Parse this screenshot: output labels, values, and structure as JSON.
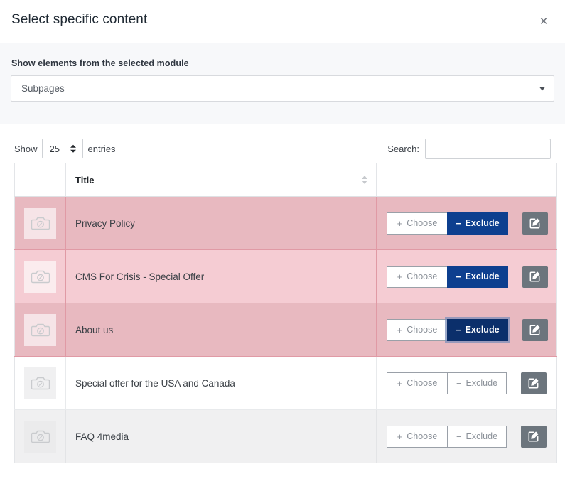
{
  "modal": {
    "title": "Select specific content",
    "close_label": "×"
  },
  "module": {
    "label": "Show elements from the selected module",
    "selected": "Subpages"
  },
  "table_controls": {
    "show_label": "Show",
    "entries_label": "entries",
    "page_length": "25",
    "search_label": "Search:",
    "search_value": "",
    "search_placeholder": ""
  },
  "table": {
    "columns": [
      "",
      "Title",
      ""
    ],
    "title_header": "Title",
    "rows": [
      {
        "title": "Privacy Policy",
        "state": "excluded",
        "row_variant": "rv-excluded-a",
        "choose_label": "Choose",
        "exclude_label": "Exclude",
        "choose_active": false,
        "exclude_active": true,
        "focused": false
      },
      {
        "title": "CMS For Crisis - Special Offer",
        "state": "excluded",
        "row_variant": "rv-excluded-b",
        "choose_label": "Choose",
        "exclude_label": "Exclude",
        "choose_active": false,
        "exclude_active": true,
        "focused": false
      },
      {
        "title": "About us",
        "state": "excluded",
        "row_variant": "rv-excluded-a",
        "choose_label": "Choose",
        "exclude_label": "Exclude",
        "choose_active": false,
        "exclude_active": true,
        "focused": true
      },
      {
        "title": "Special offer for the USA and Canada",
        "state": "none",
        "row_variant": "rv-plain",
        "choose_label": "Choose",
        "exclude_label": "Exclude",
        "choose_active": false,
        "exclude_active": false,
        "focused": false
      },
      {
        "title": "FAQ 4media",
        "state": "none",
        "row_variant": "rv-striped",
        "choose_label": "Choose",
        "exclude_label": "Exclude",
        "choose_active": false,
        "exclude_active": false,
        "focused": false
      }
    ],
    "glyphs": {
      "choose": "+",
      "exclude": "−"
    }
  },
  "colors": {
    "exclude_active_bg": "#0d3f8f",
    "exclude_focused_bg": "#0b2f6b",
    "row_excluded_dark": "#e8b9c0",
    "row_excluded_light": "#f5ccd3",
    "row_striped": "#f0f0f1",
    "edit_button_bg": "#6c757d",
    "band_bg": "#f7f8fa"
  }
}
